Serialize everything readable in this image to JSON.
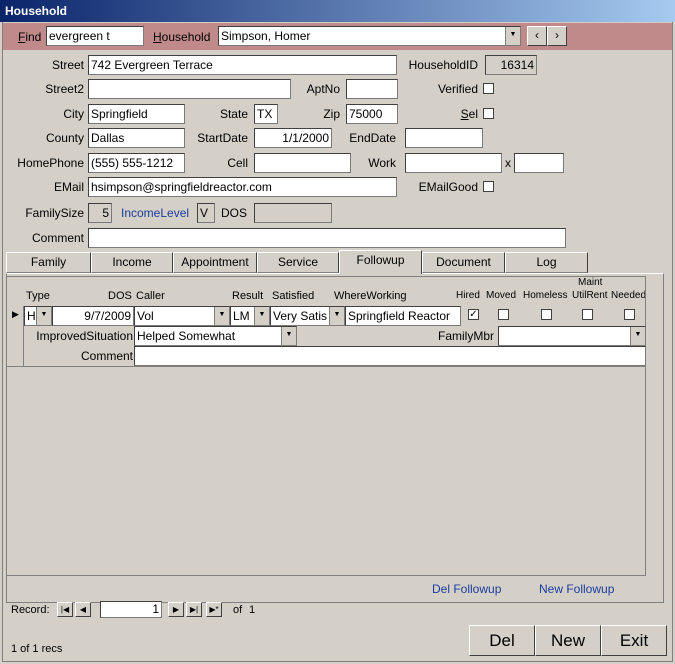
{
  "window": {
    "title": "Household"
  },
  "find": {
    "label": "Find",
    "value": "evergreen t",
    "household_label": "Household",
    "household_value": "Simpson, Homer"
  },
  "fields": {
    "street_label": "Street",
    "street": "742 Evergreen Terrace",
    "householdid_label": "HouseholdID",
    "householdid": "16314",
    "street2_label": "Street2",
    "street2": "",
    "aptno_label": "AptNo",
    "aptno": "",
    "verified_label": "Verified",
    "city_label": "City",
    "city": "Springfield",
    "state_label": "State",
    "state": "TX",
    "zip_label": "Zip",
    "zip": "75000",
    "sel_label": "Sel",
    "county_label": "County",
    "county": "Dallas",
    "startdate_label": "StartDate",
    "startdate": "1/1/2000",
    "enddate_label": "EndDate",
    "enddate": "",
    "homephone_label": "HomePhone",
    "homephone": "(555) 555-1212",
    "cell_label": "Cell",
    "cell": "",
    "work_label": "Work",
    "work": "",
    "ext_label": "x",
    "ext": "",
    "email_label": "EMail",
    "email": "hsimpson@springfieldreactor.com",
    "emailgood_label": "EMailGood",
    "familysize_label": "FamilySize",
    "familysize": "5",
    "incomelevel_label": "IncomeLevel",
    "incomelevel": "V",
    "dos_label": "DOS",
    "dos": "",
    "comment_label": "Comment",
    "comment": ""
  },
  "tabs": [
    "Family",
    "Income",
    "Appointment",
    "Service",
    "Followup",
    "Document",
    "Log"
  ],
  "active_tab": "Followup",
  "followup": {
    "headers": {
      "type": "Type",
      "dos": "DOS",
      "caller": "Caller",
      "result": "Result",
      "satisfied": "Satisfied",
      "whereworking": "WhereWorking",
      "hired": "Hired",
      "moved": "Moved",
      "homeless": "Homeless",
      "maint_top": "Maint",
      "maint_bottom": "UtilRent",
      "needed": "Needed"
    },
    "row": {
      "type": "Ho",
      "dos": "9/7/2009",
      "caller": "Vol",
      "result": "LM",
      "satisfied": "Very Satis",
      "whereworking": "Springfield Reactor",
      "improved_label": "ImprovedSituation",
      "improved": "Helped Somewhat",
      "familymbr_label": "FamilyMbr",
      "familymbr": "",
      "comment_label": "Comment",
      "comment": ""
    },
    "checks": {
      "hired": true,
      "moved": false,
      "homeless": false,
      "maint": false,
      "needed": false
    },
    "del_link": "Del Followup",
    "new_link": "New Followup"
  },
  "nav": {
    "record_label": "Record:",
    "current": "1",
    "of_label": "of",
    "total": "1"
  },
  "status": "1 of 1 recs",
  "buttons": {
    "del": "Del",
    "new": "New",
    "exit": "Exit"
  }
}
